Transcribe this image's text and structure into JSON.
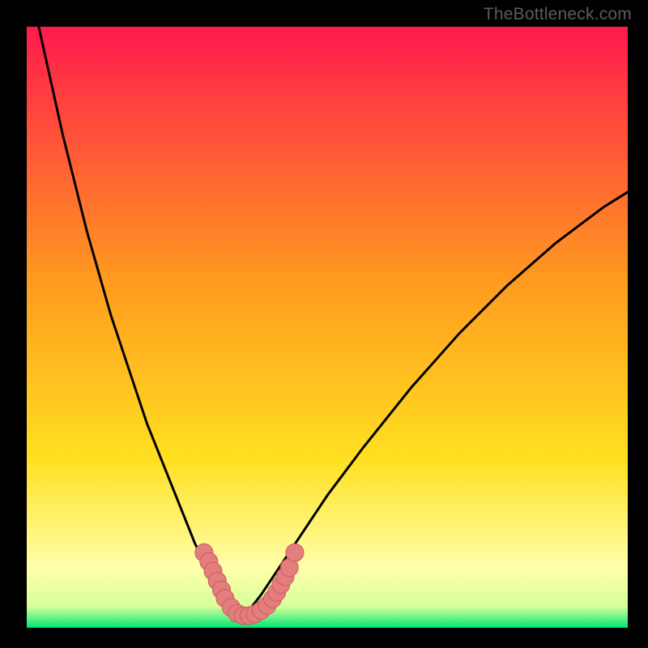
{
  "watermark": "TheBottleneck.com",
  "colors": {
    "frame": "#000000",
    "gradient_top": "#ff1a4d",
    "gradient_mid": "#ffd400",
    "gradient_whitish": "#ffffb0",
    "gradient_bottom": "#00e676",
    "curve_stroke": "#000000",
    "marker_fill": "#e47e7e",
    "marker_stroke": "#c95b5b",
    "watermark": "#5c5c5c"
  },
  "chart_data": {
    "type": "line",
    "title": "",
    "xlabel": "",
    "ylabel": "",
    "xlim": [
      0,
      100
    ],
    "ylim": [
      0,
      100
    ],
    "series": [
      {
        "name": "left-curve",
        "x": [
          2,
          4,
          6,
          8,
          10,
          12,
          14,
          16,
          18,
          20,
          22,
          24,
          26,
          28,
          29,
          30,
          31,
          32,
          33,
          34,
          35,
          36
        ],
        "y": [
          100,
          91,
          82,
          74,
          66,
          59,
          52,
          46,
          40,
          34,
          29,
          24,
          19,
          14,
          12,
          10.5,
          9,
          7.5,
          6,
          4.5,
          3.2,
          2
        ],
        "stroke": "#000000"
      },
      {
        "name": "right-curve",
        "x": [
          36,
          37,
          38,
          39,
          40,
          42,
          44,
          46,
          48,
          50,
          53,
          56,
          60,
          64,
          68,
          72,
          76,
          80,
          84,
          88,
          92,
          96,
          100
        ],
        "y": [
          2,
          3,
          4.2,
          5.5,
          7,
          10,
          13,
          16,
          19,
          22,
          26,
          30,
          35,
          40,
          44.5,
          49,
          53,
          57,
          60.5,
          64,
          67,
          70,
          72.5
        ],
        "stroke": "#000000"
      }
    ],
    "markers": {
      "name": "valley-markers",
      "points": [
        {
          "x": 29.5,
          "y": 12.5
        },
        {
          "x": 30.3,
          "y": 11.0
        },
        {
          "x": 31.0,
          "y": 9.4
        },
        {
          "x": 31.7,
          "y": 7.8
        },
        {
          "x": 32.4,
          "y": 6.3
        },
        {
          "x": 33.0,
          "y": 4.9
        },
        {
          "x": 34.0,
          "y": 3.4
        },
        {
          "x": 35.0,
          "y": 2.4
        },
        {
          "x": 36.0,
          "y": 2.0
        },
        {
          "x": 37.0,
          "y": 2.0
        },
        {
          "x": 38.0,
          "y": 2.3
        },
        {
          "x": 39.0,
          "y": 2.9
        },
        {
          "x": 40.0,
          "y": 3.7
        },
        {
          "x": 40.9,
          "y": 4.8
        },
        {
          "x": 41.6,
          "y": 5.9
        },
        {
          "x": 42.3,
          "y": 7.2
        },
        {
          "x": 43.0,
          "y": 8.5
        },
        {
          "x": 43.7,
          "y": 10.0
        },
        {
          "x": 44.6,
          "y": 12.5
        }
      ],
      "radius": 11
    },
    "gradient_stops": [
      {
        "offset": 0.0,
        "color": "#ff1a4d"
      },
      {
        "offset": 0.42,
        "color": "#ff9a1f"
      },
      {
        "offset": 0.72,
        "color": "#ffe020"
      },
      {
        "offset": 0.9,
        "color": "#ffffaa"
      },
      {
        "offset": 0.965,
        "color": "#d6ff9a"
      },
      {
        "offset": 1.0,
        "color": "#00e676"
      }
    ]
  }
}
